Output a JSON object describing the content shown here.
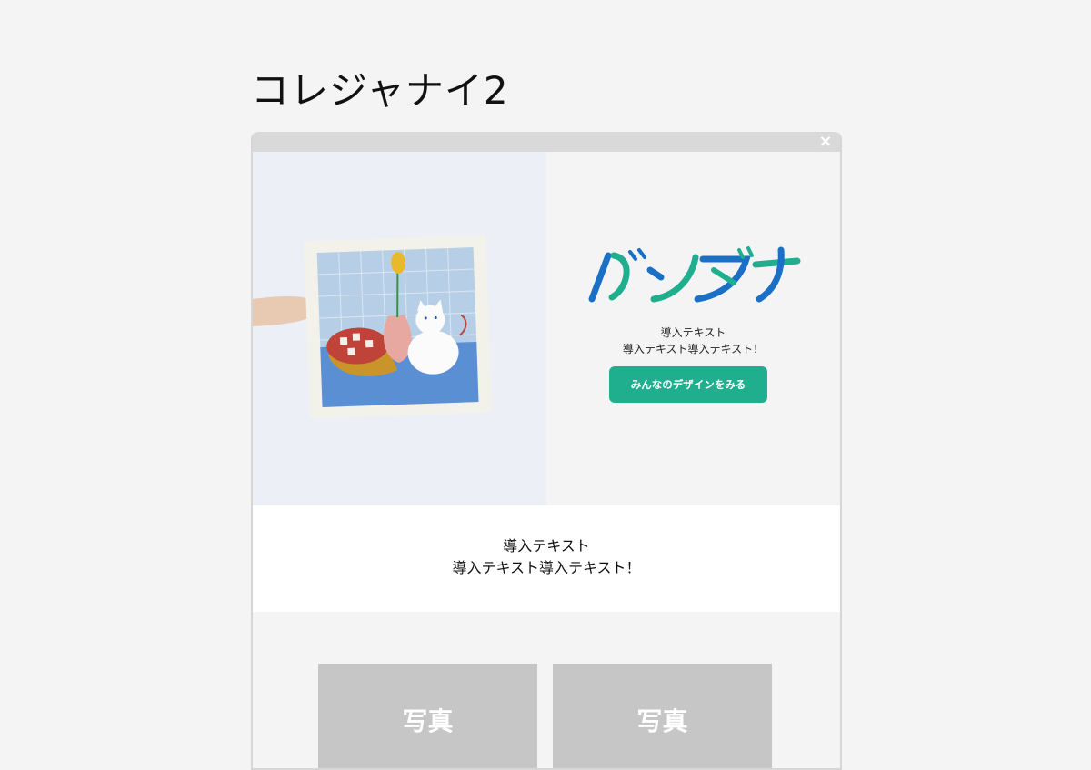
{
  "page": {
    "title": "コレジャナイ2"
  },
  "modal": {
    "close_label": "×",
    "hero": {
      "logo_text": "バンダナ",
      "intro_lines": [
        "導入テキスト",
        "導入テキスト導入テキスト！"
      ],
      "cta_label": "みんなのデザインをみる"
    },
    "intro": {
      "lines": [
        "導入テキスト",
        "導入テキスト導入テキスト！"
      ]
    },
    "photos": [
      {
        "label": "写真"
      },
      {
        "label": "写真"
      }
    ]
  },
  "colors": {
    "accent": "#1fae8e",
    "logo_blue": "#1a6fc6",
    "logo_green": "#1fae8e",
    "placeholder_gray": "#c6c6c6"
  },
  "icons": [
    "close-icon"
  ]
}
